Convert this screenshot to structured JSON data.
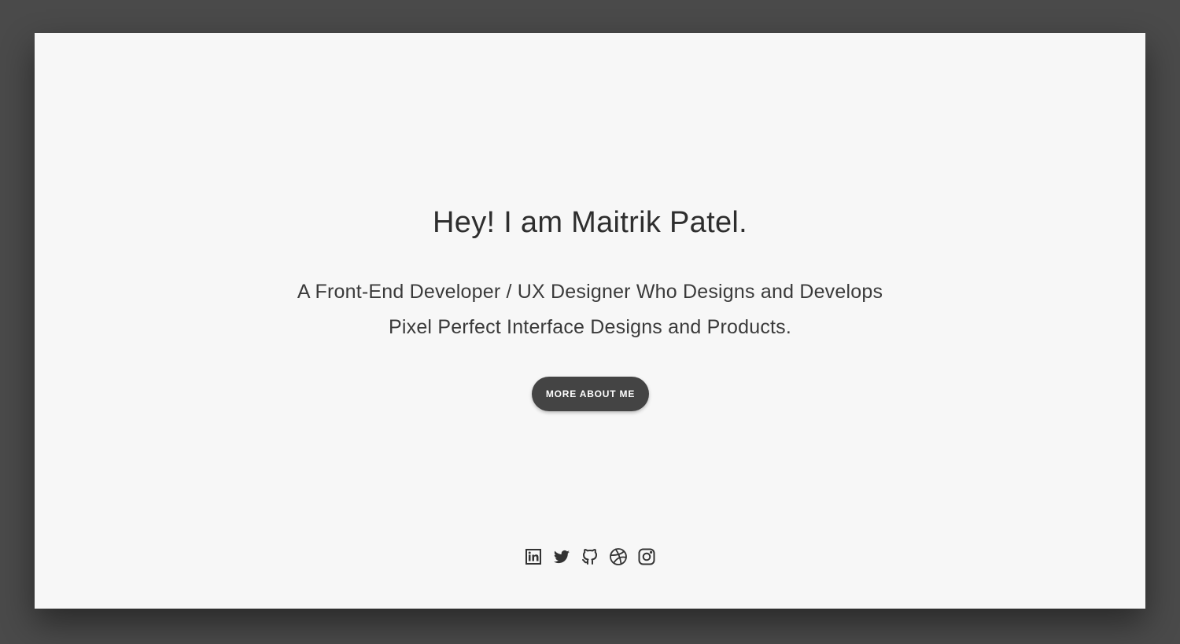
{
  "hero": {
    "title": "Hey! I am Maitrik Patel.",
    "subtitle_line1": "A Front-End Developer / UX Designer Who Designs and Develops",
    "subtitle_line2": "Pixel Perfect Interface Designs and Products.",
    "cta_label": "MORE ABOUT ME"
  },
  "social": {
    "icons": [
      "linkedin-icon",
      "twitter-icon",
      "github-icon",
      "dribbble-icon",
      "instagram-icon"
    ]
  },
  "colors": {
    "background_outer": "#4a4a4a",
    "card": "#f7f7f7",
    "text": "#333333",
    "button": "#444444",
    "button_text": "#ffffff"
  }
}
